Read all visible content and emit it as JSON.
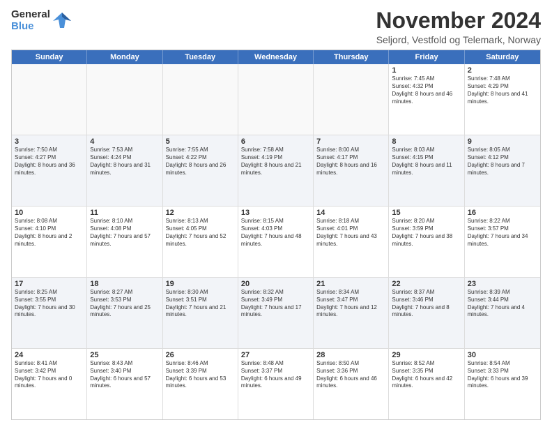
{
  "logo": {
    "line1": "General",
    "line2": "Blue"
  },
  "title": "November 2024",
  "subtitle": "Seljord, Vestfold og Telemark, Norway",
  "headers": [
    "Sunday",
    "Monday",
    "Tuesday",
    "Wednesday",
    "Thursday",
    "Friday",
    "Saturday"
  ],
  "weeks": [
    [
      {
        "day": "",
        "info": ""
      },
      {
        "day": "",
        "info": ""
      },
      {
        "day": "",
        "info": ""
      },
      {
        "day": "",
        "info": ""
      },
      {
        "day": "",
        "info": ""
      },
      {
        "day": "1",
        "info": "Sunrise: 7:45 AM\nSunset: 4:32 PM\nDaylight: 8 hours and 46 minutes."
      },
      {
        "day": "2",
        "info": "Sunrise: 7:48 AM\nSunset: 4:29 PM\nDaylight: 8 hours and 41 minutes."
      }
    ],
    [
      {
        "day": "3",
        "info": "Sunrise: 7:50 AM\nSunset: 4:27 PM\nDaylight: 8 hours and 36 minutes."
      },
      {
        "day": "4",
        "info": "Sunrise: 7:53 AM\nSunset: 4:24 PM\nDaylight: 8 hours and 31 minutes."
      },
      {
        "day": "5",
        "info": "Sunrise: 7:55 AM\nSunset: 4:22 PM\nDaylight: 8 hours and 26 minutes."
      },
      {
        "day": "6",
        "info": "Sunrise: 7:58 AM\nSunset: 4:19 PM\nDaylight: 8 hours and 21 minutes."
      },
      {
        "day": "7",
        "info": "Sunrise: 8:00 AM\nSunset: 4:17 PM\nDaylight: 8 hours and 16 minutes."
      },
      {
        "day": "8",
        "info": "Sunrise: 8:03 AM\nSunset: 4:15 PM\nDaylight: 8 hours and 11 minutes."
      },
      {
        "day": "9",
        "info": "Sunrise: 8:05 AM\nSunset: 4:12 PM\nDaylight: 8 hours and 7 minutes."
      }
    ],
    [
      {
        "day": "10",
        "info": "Sunrise: 8:08 AM\nSunset: 4:10 PM\nDaylight: 8 hours and 2 minutes."
      },
      {
        "day": "11",
        "info": "Sunrise: 8:10 AM\nSunset: 4:08 PM\nDaylight: 7 hours and 57 minutes."
      },
      {
        "day": "12",
        "info": "Sunrise: 8:13 AM\nSunset: 4:05 PM\nDaylight: 7 hours and 52 minutes."
      },
      {
        "day": "13",
        "info": "Sunrise: 8:15 AM\nSunset: 4:03 PM\nDaylight: 7 hours and 48 minutes."
      },
      {
        "day": "14",
        "info": "Sunrise: 8:18 AM\nSunset: 4:01 PM\nDaylight: 7 hours and 43 minutes."
      },
      {
        "day": "15",
        "info": "Sunrise: 8:20 AM\nSunset: 3:59 PM\nDaylight: 7 hours and 38 minutes."
      },
      {
        "day": "16",
        "info": "Sunrise: 8:22 AM\nSunset: 3:57 PM\nDaylight: 7 hours and 34 minutes."
      }
    ],
    [
      {
        "day": "17",
        "info": "Sunrise: 8:25 AM\nSunset: 3:55 PM\nDaylight: 7 hours and 30 minutes."
      },
      {
        "day": "18",
        "info": "Sunrise: 8:27 AM\nSunset: 3:53 PM\nDaylight: 7 hours and 25 minutes."
      },
      {
        "day": "19",
        "info": "Sunrise: 8:30 AM\nSunset: 3:51 PM\nDaylight: 7 hours and 21 minutes."
      },
      {
        "day": "20",
        "info": "Sunrise: 8:32 AM\nSunset: 3:49 PM\nDaylight: 7 hours and 17 minutes."
      },
      {
        "day": "21",
        "info": "Sunrise: 8:34 AM\nSunset: 3:47 PM\nDaylight: 7 hours and 12 minutes."
      },
      {
        "day": "22",
        "info": "Sunrise: 8:37 AM\nSunset: 3:46 PM\nDaylight: 7 hours and 8 minutes."
      },
      {
        "day": "23",
        "info": "Sunrise: 8:39 AM\nSunset: 3:44 PM\nDaylight: 7 hours and 4 minutes."
      }
    ],
    [
      {
        "day": "24",
        "info": "Sunrise: 8:41 AM\nSunset: 3:42 PM\nDaylight: 7 hours and 0 minutes."
      },
      {
        "day": "25",
        "info": "Sunrise: 8:43 AM\nSunset: 3:40 PM\nDaylight: 6 hours and 57 minutes."
      },
      {
        "day": "26",
        "info": "Sunrise: 8:46 AM\nSunset: 3:39 PM\nDaylight: 6 hours and 53 minutes."
      },
      {
        "day": "27",
        "info": "Sunrise: 8:48 AM\nSunset: 3:37 PM\nDaylight: 6 hours and 49 minutes."
      },
      {
        "day": "28",
        "info": "Sunrise: 8:50 AM\nSunset: 3:36 PM\nDaylight: 6 hours and 46 minutes."
      },
      {
        "day": "29",
        "info": "Sunrise: 8:52 AM\nSunset: 3:35 PM\nDaylight: 6 hours and 42 minutes."
      },
      {
        "day": "30",
        "info": "Sunrise: 8:54 AM\nSunset: 3:33 PM\nDaylight: 6 hours and 39 minutes."
      }
    ]
  ]
}
